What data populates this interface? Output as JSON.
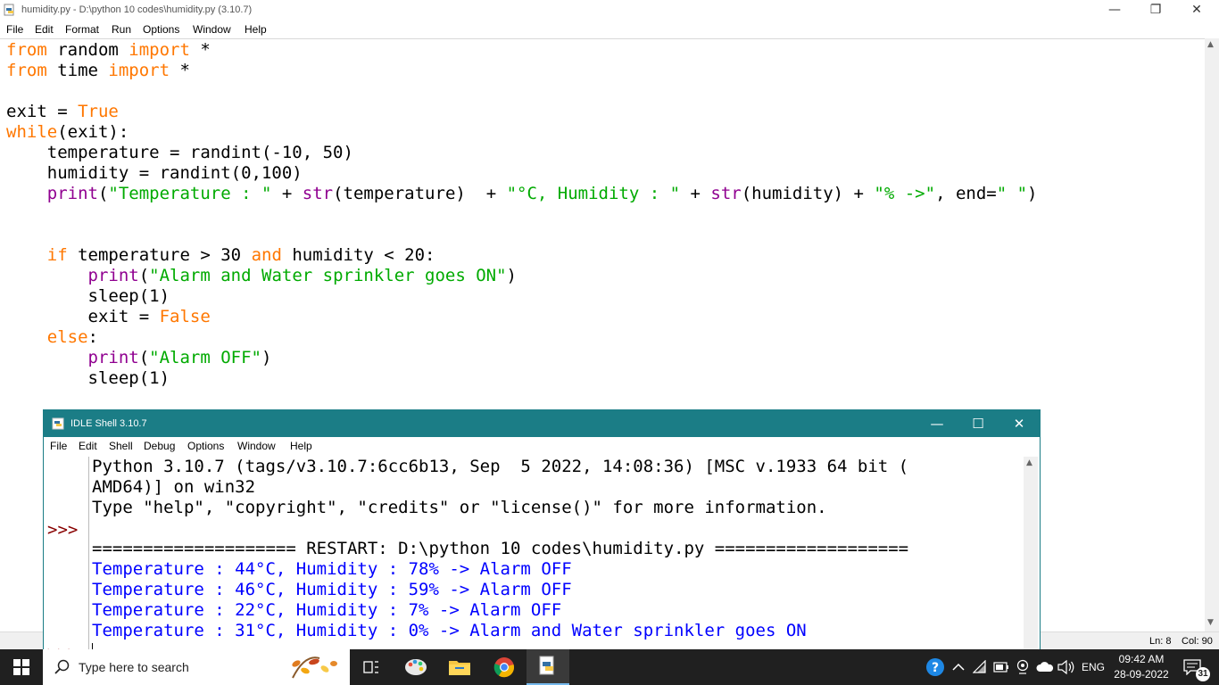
{
  "editor": {
    "title": "humidity.py - D:\\python 10 codes\\humidity.py (3.10.7)",
    "menu": [
      "File",
      "Edit",
      "Format",
      "Run",
      "Options",
      "Window",
      "Help"
    ],
    "status": {
      "line": "Ln: 8",
      "col": "Col: 90"
    }
  },
  "code": {
    "l1": {
      "a": "from",
      "b": " random ",
      "c": "import",
      "d": " *"
    },
    "l2": {
      "a": "from",
      "b": " time ",
      "c": "import",
      "d": " *"
    },
    "l4": {
      "a": "exit = ",
      "b": "True"
    },
    "l5": {
      "a": "while",
      "b": "(exit):"
    },
    "l6": "    temperature = randint(-10, 50)",
    "l7": "    humidity = randint(0,100)",
    "l8": {
      "indent": "    ",
      "p1": "print",
      "p2": "(",
      "s1": "\"Temperature : \"",
      "p3": " + ",
      "f1": "str",
      "p4": "(temperature)  + ",
      "s2": "\"°C, Humidity : \"",
      "p5": " + ",
      "f2": "str",
      "p6": "(humidity) + ",
      "s3": "\"% ->\"",
      "p7": ", end=",
      "s4": "\" \"",
      "p8": ")"
    },
    "l11": {
      "indent": "    ",
      "k1": "if",
      "t1": " temperature > 30 ",
      "k2": "and",
      "t2": " humidity < 20:"
    },
    "l12": {
      "indent": "        ",
      "f": "print",
      "p": "(",
      "s": "\"Alarm and Water sprinkler goes ON\"",
      "e": ")"
    },
    "l13": "        sleep(1)",
    "l14": {
      "indent": "        ",
      "a": "exit = ",
      "b": "False"
    },
    "l15": {
      "indent": "    ",
      "k": "else",
      "t": ":"
    },
    "l16": {
      "indent": "        ",
      "f": "print",
      "p": "(",
      "s": "\"Alarm OFF\"",
      "e": ")"
    },
    "l17": "        sleep(1)"
  },
  "shell": {
    "title": "IDLE Shell 3.10.7",
    "menu": [
      "File",
      "Edit",
      "Shell",
      "Debug",
      "Options",
      "Window",
      "Help"
    ],
    "prompt": ">>>",
    "lines": [
      "Python 3.10.7 (tags/v3.10.7:6cc6b13, Sep  5 2022, 14:08:36) [MSC v.1933 64 bit (",
      "AMD64)] on win32",
      "Type \"help\", \"copyright\", \"credits\" or \"license()\" for more information.",
      "==================== RESTART: D:\\python 10 codes\\humidity.py ==================="
    ],
    "output": [
      "Temperature : 44°C, Humidity : 78% -> Alarm OFF",
      "Temperature : 46°C, Humidity : 59% -> Alarm OFF",
      "Temperature : 22°C, Humidity : 7% -> Alarm OFF",
      "Temperature : 31°C, Humidity : 0% -> Alarm and Water sprinkler goes ON"
    ]
  },
  "taskbar": {
    "search_placeholder": "Type here to search",
    "language": "ENG",
    "time": "09:42 AM",
    "date": "28-09-2022",
    "notification_count": "31"
  },
  "colors": {
    "keyword": "#ff7700",
    "builtin": "#900090",
    "string": "#00aa00",
    "output": "#0000ff",
    "prompt": "#880000",
    "shell_title": "#1b7d86",
    "taskbar": "#202020"
  }
}
